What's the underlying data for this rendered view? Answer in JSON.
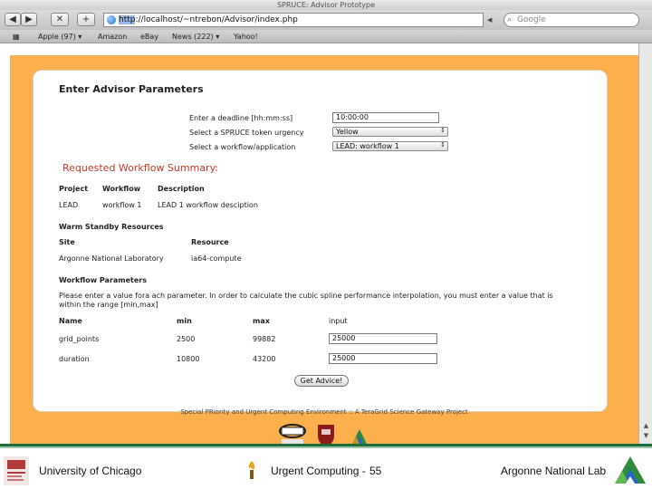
{
  "window": {
    "title": "SPRUCE: Advisor Prototype"
  },
  "toolbar": {
    "back": "◀",
    "forward": "▶",
    "stop": "✕",
    "add": "+",
    "url_prefix": "http",
    "url_rest": "://localhost/~ntrebon/Advisor/index.php",
    "search_placeholder": "Google"
  },
  "bookmarks": [
    "Apple (97) ▾",
    "Amazon",
    "eBay",
    "News (222) ▾",
    "Yahoo!"
  ],
  "form": {
    "title": "Enter Advisor Parameters",
    "deadline_label": "Enter a deadline [hh:mm:ss]",
    "deadline_value": "10:00:00",
    "urgency_label": "Select a SPRUCE token urgency",
    "urgency_value": "Yellow",
    "workflow_label": "Select a workflow/application",
    "workflow_value": "LEAD: workflow 1"
  },
  "summary": {
    "title": "Requested Workflow Summary:",
    "headers": [
      "Project",
      "Workflow",
      "Description"
    ],
    "row": [
      "LEAD",
      "workflow 1",
      "LEAD 1 workflow desciption"
    ]
  },
  "standby": {
    "title": "Warm Standby Resources",
    "headers": [
      "Site",
      "Resource"
    ],
    "row": [
      "Argonne National Laboratory",
      "ia64-compute"
    ]
  },
  "params": {
    "title": "Workflow Parameters",
    "instructions": "Please enter a value fora ach parameter. In order to calculate the cubic spline performance interpolation, you must enter a value that is within the range [min,max]",
    "headers": [
      "Name",
      "min",
      "max",
      "input"
    ],
    "rows": [
      {
        "name": "grid_points",
        "min": "2500",
        "max": "99882",
        "input": "25000"
      },
      {
        "name": "duration",
        "min": "10800",
        "max": "43200",
        "input": "25000"
      }
    ],
    "button": "Get Advice!"
  },
  "page_footer": "Special PRiority and Urgent Computing Environment :: A TeraGrid Science Gateway Project",
  "slide_footer": {
    "left": "University of Chicago",
    "center": "Urgent Computing -",
    "page": "55",
    "right": "Argonne National Lab"
  },
  "colors": {
    "orange": "#fbb04d",
    "heading_red": "#c0392b",
    "footer_green": "#1f6b3a"
  }
}
